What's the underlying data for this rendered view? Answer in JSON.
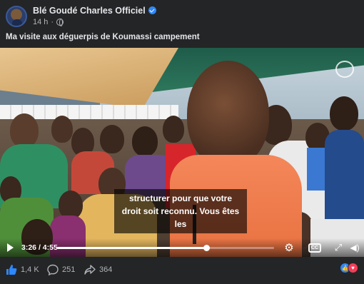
{
  "post": {
    "page_name": "Blé Goudé Charles Officiel",
    "time": "14 h",
    "separator": "·",
    "caption": "Ma visite aux déguerpis de Koumassi campement"
  },
  "video": {
    "subtitle": "structurer pour que votre droit soit reconnu. Vous êtes les",
    "current_time": "3:26",
    "time_separator": "/",
    "duration": "4:55",
    "progress": 0.69
  },
  "actions": {
    "likes": "1,4 K",
    "comments": "251",
    "shares": "364"
  },
  "icons": {
    "verified": "verified-badge-icon",
    "audience": "globe-icon",
    "play": "play-icon",
    "settings": "gear-icon",
    "captions": "cc-icon",
    "fullscreen": "fullscreen-icon",
    "volume": "volume-icon"
  },
  "colors": {
    "background": "#242526",
    "accent": "#2d88ff",
    "love": "#f33e58"
  }
}
